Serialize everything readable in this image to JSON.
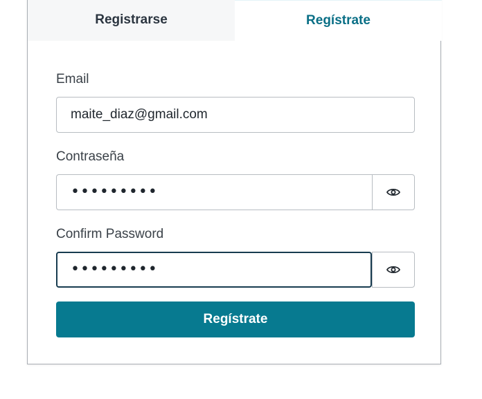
{
  "tabs": [
    {
      "label": "Registrarse",
      "active": false
    },
    {
      "label": "Regístrate",
      "active": true
    }
  ],
  "form": {
    "email": {
      "label": "Email",
      "value": "maite_diaz@gmail.com"
    },
    "password": {
      "label": "Contraseña",
      "masked_value": "•••••••••",
      "toggle_icon": "eye-icon"
    },
    "confirm_password": {
      "label": "Confirm Password",
      "masked_value": "•••••••••",
      "toggle_icon": "eye-icon"
    },
    "submit_label": "Regístrate"
  },
  "colors": {
    "accent": "#077a90",
    "active_tab_text": "#0a6f86",
    "inactive_tab_bg": "#f6f7f8"
  }
}
